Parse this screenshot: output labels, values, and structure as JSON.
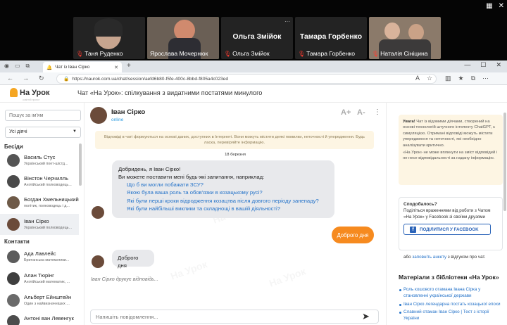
{
  "call": {
    "participants": [
      {
        "name": "Таня Руденко",
        "big": ""
      },
      {
        "name": "Ярослава Мочернюк",
        "big": ""
      },
      {
        "name": "Ольга Змійок",
        "big": "Ольга Змійок"
      },
      {
        "name": "Тамара Горбенко",
        "big": "Тамара Горбенко"
      },
      {
        "name": "Наталія Сініцина",
        "big": ""
      }
    ]
  },
  "browser": {
    "tab_title": "Чат із Іван Сірко",
    "url": "https://naurok.com.ua/chat/session/aefd6b80-f5fe-400c-8bbd-f805a4c023ed"
  },
  "header": {
    "logo": "На Урок",
    "logo_sub": "освітній проект",
    "title": "Чат «На Урок»: спілкування з видатними постатями минулого"
  },
  "sidebar": {
    "search_placeholder": "Пошук за ім'ям",
    "filter": "Усі діячі",
    "section_conversations": "Бесіди",
    "section_contacts": "Контакти",
    "conversations": [
      {
        "name": "Василь Стус",
        "desc": "Український поет-шістд..."
      },
      {
        "name": "Вінстон Черчилль",
        "desc": "Англійський полководець..."
      },
      {
        "name": "Богдан Хмельницький",
        "desc": "політик, полководець і д..."
      },
      {
        "name": "Іван Сірко",
        "desc": "Український полководець..."
      }
    ],
    "contacts": [
      {
        "name": "Ада Лавлейс",
        "desc": "Британська математики..."
      },
      {
        "name": "Алан Тюрінг",
        "desc": "Англійський математик, ..."
      },
      {
        "name": "Альберт Ейнштейн",
        "desc": "Один з найвизначніших ..."
      },
      {
        "name": "Антоні ван Левенгук",
        "desc": ""
      }
    ]
  },
  "chat": {
    "name": "Іван Сірко",
    "status": "online",
    "font_plus": "A+",
    "font_minus": "A-",
    "notice": "Відповіді в чаті формуються на основі даних, доступних в Інтернеті. Вони можуть містити деякі помилки, неточності й упередження. Будь ласка, перевіряйте інформацію.",
    "date": "18 березня",
    "greeting_line1": "Добридень, я Іван Сірко!",
    "greeting_line2": "Ви можете поставити мені будь-які запитання, наприклад:",
    "suggestions": [
      "Що б ви могли побажати ЗСУ?",
      "Якою була ваша роль та обов'язки в козацькому русі?",
      "Які були перші кроки відродження козацтва після довгого періоду занепаду?",
      "Які були найбільші виклики та складнощі в вашій діяльності?"
    ],
    "user_message": "Доброго дня",
    "bot_reply": "Доброго дня",
    "typing": "Іван Сірко друкує відповідь...",
    "input_placeholder": "Напишіть повідомлення...",
    "watermark": "На Урок"
  },
  "right": {
    "warn_bold": "Увага!",
    "warn_text": " Чат із відомими діячами, створений на основі технологій штучного інтелекту ChatGPT, є симуляцією. Отримані відповіді можуть містити упередження та неточності, які необхідно аналізувати критично.",
    "warn_text2": "«На Урок» не може вплинути на зміст відповідей і не несе відповідальності за надану інформацію.",
    "fb_title": "Сподобалось?",
    "fb_text": "Поділіться враженнями від роботи з Чатом «На Урок» у Facebook зі своїми друзями",
    "fb_button": "ПОДІЛИТИСЯ У FACEBOOK",
    "fb_link_pre": "або ",
    "fb_link": "заповніть анкету",
    "fb_link_post": " з відгуком про чат.",
    "materials_title": "Матеріали з бібліотеки «На Урок»",
    "materials": [
      "Роль кошового отамана Івана Сірка у становленні української держави",
      "Іван Сірко легендарна постать козацької епохи",
      "Славний отаман Іван Сірко | Тест з історії України"
    ]
  }
}
